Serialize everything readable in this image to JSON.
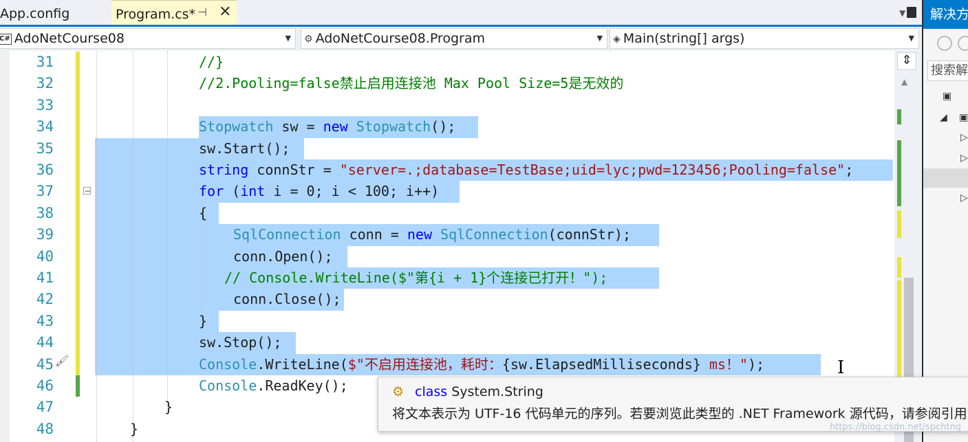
{
  "tabs": {
    "inactive": "App.config",
    "active": "Program.cs*",
    "pin_icon": "pin-icon",
    "close_icon": "close-icon"
  },
  "navbar": {
    "project_badge": "C#",
    "project": "AdoNetCourse08",
    "class": "AdoNetCourse08.Program",
    "member": "Main(string[] args)"
  },
  "line_numbers": [
    "31",
    "32",
    "33",
    "34",
    "35",
    "36",
    "37",
    "38",
    "39",
    "40",
    "41",
    "42",
    "43",
    "44",
    "45",
    "46",
    "47",
    "48"
  ],
  "code_lines": [
    [
      {
        "t": "//}",
        "c": "cm"
      }
    ],
    [
      {
        "t": "//2.Pooling=false禁止启用连接池 Max Pool Size=5是无效的",
        "c": "cm"
      }
    ],
    [],
    [
      {
        "t": "Stopwatch",
        "c": "ty"
      },
      {
        "t": " sw = ",
        "c": "tx"
      },
      {
        "t": "new",
        "c": "kw"
      },
      {
        "t": " ",
        "c": "tx"
      },
      {
        "t": "Stopwatch",
        "c": "ty"
      },
      {
        "t": "();",
        "c": "tx"
      }
    ],
    [
      {
        "t": "sw.Start();",
        "c": "tx"
      }
    ],
    [
      {
        "t": "string",
        "c": "kw"
      },
      {
        "t": " connStr = ",
        "c": "tx"
      },
      {
        "t": "\"server=.;database=TestBase;uid=lyc;pwd=123456;Pooling=false\"",
        "c": "st"
      },
      {
        "t": ";",
        "c": "tx"
      }
    ],
    [
      {
        "t": "for",
        "c": "kw"
      },
      {
        "t": " (",
        "c": "tx"
      },
      {
        "t": "int",
        "c": "kw"
      },
      {
        "t": " i = 0; i < 100; i++)",
        "c": "tx"
      }
    ],
    [
      {
        "t": "{",
        "c": "tx"
      }
    ],
    [
      {
        "t": "SqlConnection",
        "c": "ty"
      },
      {
        "t": " conn = ",
        "c": "tx"
      },
      {
        "t": "new",
        "c": "kw"
      },
      {
        "t": " ",
        "c": "tx"
      },
      {
        "t": "SqlConnection",
        "c": "ty"
      },
      {
        "t": "(connStr);",
        "c": "tx"
      }
    ],
    [
      {
        "t": "conn.Open();",
        "c": "tx"
      }
    ],
    [
      {
        "t": "// Console.WriteLine($\"第{i + 1}个连接已打开！\");",
        "c": "cm"
      }
    ],
    [
      {
        "t": "conn.Close();",
        "c": "tx"
      }
    ],
    [
      {
        "t": "}",
        "c": "tx"
      }
    ],
    [
      {
        "t": "sw.Stop();",
        "c": "tx"
      }
    ],
    [
      {
        "t": "Console",
        "c": "ty"
      },
      {
        "t": ".WriteLine(",
        "c": "tx"
      },
      {
        "t": "$\"不启用连接池，耗时：",
        "c": "st"
      },
      {
        "t": "{sw.ElapsedMilliseconds}",
        "c": "tx"
      },
      {
        "t": " ms！\"",
        "c": "st"
      },
      {
        "t": ");",
        "c": "tx"
      }
    ],
    [
      {
        "t": "Console",
        "c": "ty"
      },
      {
        "t": ".ReadKey();",
        "c": "tx"
      }
    ],
    [
      {
        "t": "}",
        "c": "tx"
      }
    ],
    [
      {
        "t": "}",
        "c": "tx"
      }
    ]
  ],
  "tooltip": {
    "icon": "class-icon",
    "keyword": "class",
    "signature": "System.String",
    "description": "将文本表示为 UTF-16 代码单元的序列。若要浏览此类型的 .NET Framework 源代码，请参阅引用源"
  },
  "right_panel": {
    "title": "解决方案资源管理器",
    "search_placeholder": "搜索解决方案资源管理器"
  },
  "watermark": "https://blog.csdn.net/spchtng",
  "colors": {
    "accent": "#007acc",
    "selection": "#add6ff",
    "keyword": "#0000ff",
    "type": "#2b91af",
    "comment": "#008000",
    "string": "#a31515",
    "change_saved": "#57a64a",
    "change_unsaved": "#e8e43c"
  }
}
